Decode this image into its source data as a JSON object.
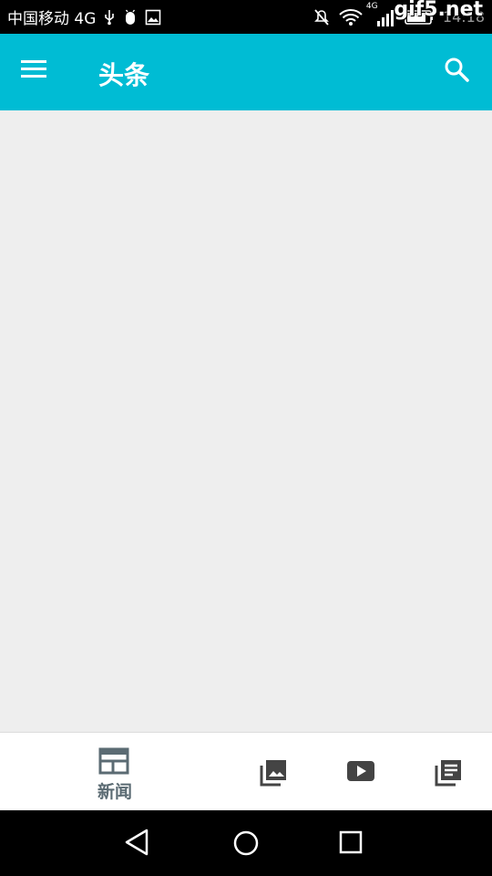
{
  "status_bar": {
    "carrier": "中国移动 4G",
    "network_badge": "4G",
    "time": "14:18",
    "watermark": "gif5.net"
  },
  "app_bar": {
    "title": "头条",
    "background": "#00bcd4"
  },
  "bottom_nav": {
    "tabs": [
      {
        "label": "新闻",
        "icon": "news-icon",
        "selected": true
      },
      {
        "label": "",
        "icon": "photo-library-icon",
        "selected": false
      },
      {
        "label": "",
        "icon": "video-play-icon",
        "selected": false
      },
      {
        "label": "",
        "icon": "library-books-icon",
        "selected": false
      }
    ],
    "active_color": "#5b6b73",
    "inactive_color": "#444444"
  },
  "system_nav": {
    "buttons": [
      "back-icon",
      "home-icon",
      "recent-apps-icon"
    ]
  }
}
